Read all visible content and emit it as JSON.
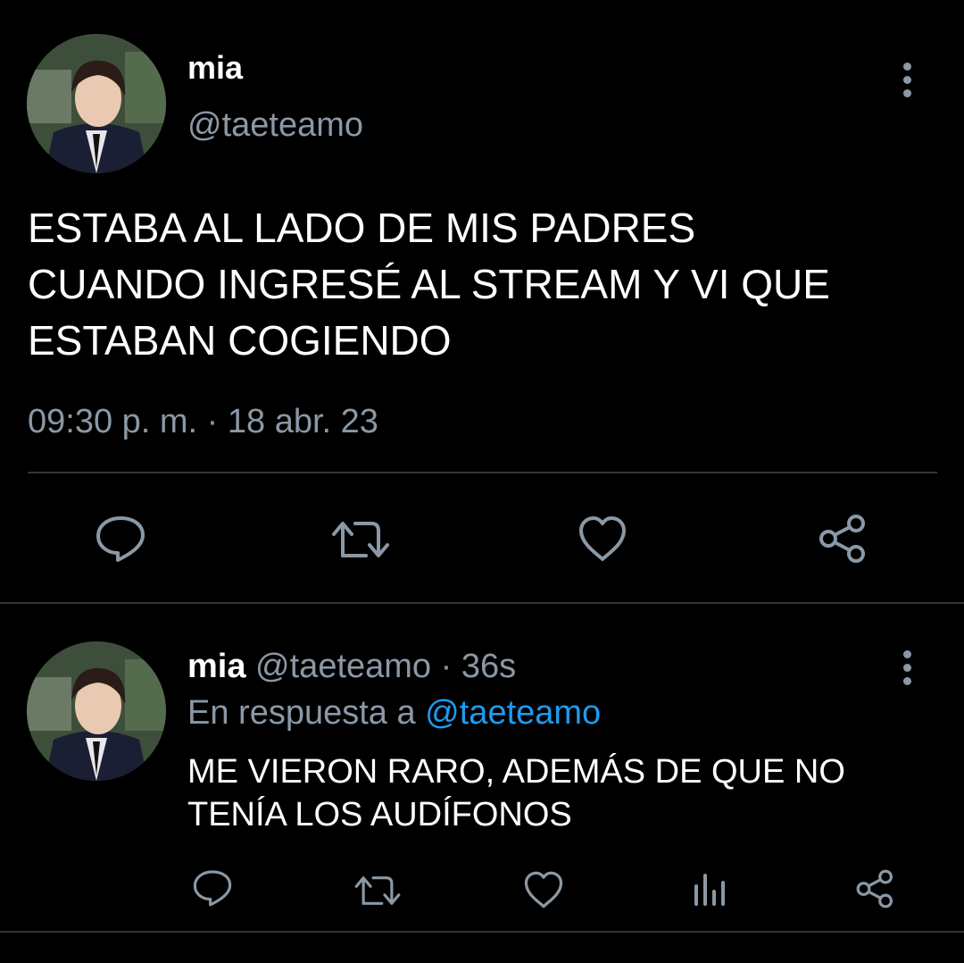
{
  "main_tweet": {
    "display_name": "mia",
    "handle": "@taeteamo",
    "text_lines": [
      "ESTABA AL LADO DE MIS PADRES",
      "CUANDO INGRESÉ AL STREAM Y VI QUE",
      "ESTABAN COGIENDO"
    ],
    "timestamp": "09:30 p. m. · 18 abr. 23",
    "actions": [
      "reply-icon",
      "retweet-icon",
      "like-icon",
      "share-icon"
    ]
  },
  "reply_tweet": {
    "display_name": "mia",
    "handle": "@taeteamo",
    "separator": "·",
    "time": "36s",
    "reply_prefix": "En respuesta a",
    "reply_to": "@taeteamo",
    "text_lines": [
      "ME VIERON RARO, ADEMÁS DE QUE NO",
      "TENÍA LOS AUDÍFONOS"
    ],
    "actions": [
      "reply-icon",
      "retweet-icon",
      "like-icon",
      "analytics-icon",
      "share-icon"
    ]
  },
  "colors": {
    "background": "#000000",
    "text": "#ffffff",
    "muted": "#8b98a5",
    "link": "#1d9bf0",
    "divider": "#2f3336"
  }
}
